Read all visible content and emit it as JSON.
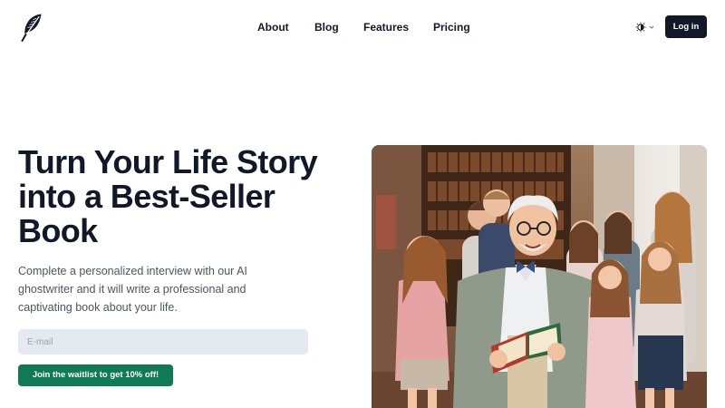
{
  "header": {
    "logo_icon": "feather-icon",
    "nav": [
      {
        "label": "About"
      },
      {
        "label": "Blog"
      },
      {
        "label": "Features"
      },
      {
        "label": "Pricing"
      }
    ],
    "theme_toggle_icon": "sun-moon-icon",
    "login_label": "Log in"
  },
  "hero": {
    "title": "Turn Your Life Story into a Best-Seller Book",
    "description": "Complete a personalized interview with our AI ghostwriter and it will write a professional and captivating book about your life.",
    "email_placeholder": "E-mail",
    "email_value": "",
    "cta_label": "Join the waitlist to get 10% off!",
    "image_subject": "grandfather-reading-book-to-children-photo"
  },
  "colors": {
    "primary_dark": "#111827",
    "cta_green": "#0f7a55",
    "input_bg": "#e5e9f0",
    "text_muted": "#4b5563"
  }
}
